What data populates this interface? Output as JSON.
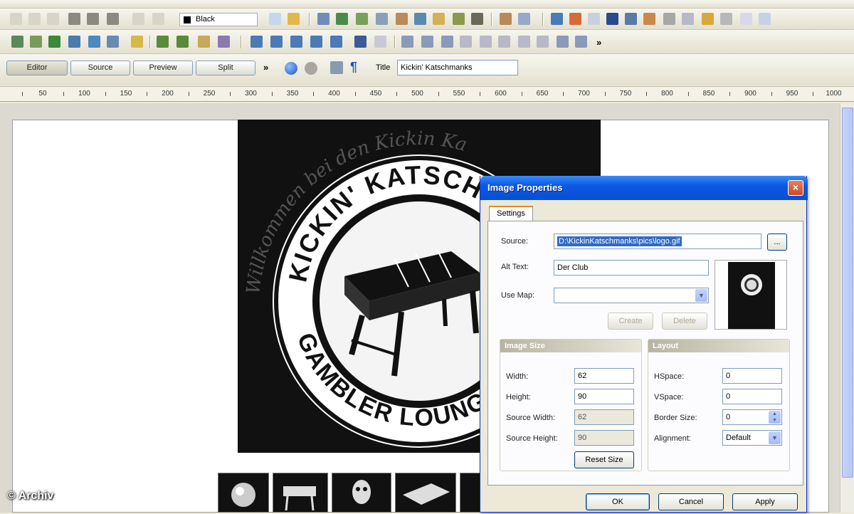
{
  "toolbar": {
    "color_value": "Black",
    "modes": [
      "Editor",
      "Source",
      "Preview",
      "Split"
    ],
    "more": "»",
    "title_label": "Title",
    "title_value": "Kickin' Katschmanks"
  },
  "ruler": {
    "labels": [
      "50",
      "100",
      "150",
      "200",
      "250",
      "300",
      "350",
      "400",
      "450",
      "500",
      "550",
      "600",
      "650",
      "700",
      "750",
      "800",
      "850",
      "900",
      "950",
      "1000"
    ]
  },
  "dialog": {
    "title": "Image Properties",
    "close": "×",
    "tab": "Settings",
    "source_label": "Source:",
    "source_value": "D:\\KickinKatschmanks\\pics\\logo.gif",
    "browse": "...",
    "alt_label": "Alt Text:",
    "alt_value": "Der Club",
    "usemap_label": "Use Map:",
    "usemap_value": "",
    "create": "Create",
    "delete": "Delete",
    "size_group": "Image Size",
    "width_label": "Width:",
    "width_value": "62",
    "height_label": "Height:",
    "height_value": "90",
    "src_width_label": "Source Width:",
    "src_width_value": "62",
    "src_height_label": "Source Height:",
    "src_height_value": "90",
    "reset": "Reset Size",
    "layout_group": "Layout",
    "hspace_label": "HSpace:",
    "hspace_value": "0",
    "vspace_label": "VSpace:",
    "vspace_value": "0",
    "border_label": "Border Size:",
    "border_value": "0",
    "align_label": "Alignment:",
    "align_value": "Default",
    "ok": "OK",
    "cancel": "Cancel",
    "apply": "Apply"
  },
  "logo": {
    "arc_top": "KICKIN' KATSCHM",
    "arc_bottom": "GAMBLER LOUNGE",
    "script": "Willkommen bei den Kickin Ka"
  },
  "watermark": "© Archiv",
  "colors": {
    "dialog_title": "#0a58e4",
    "accent_tab": "#e68b2c",
    "logo_bg": "#111111"
  }
}
